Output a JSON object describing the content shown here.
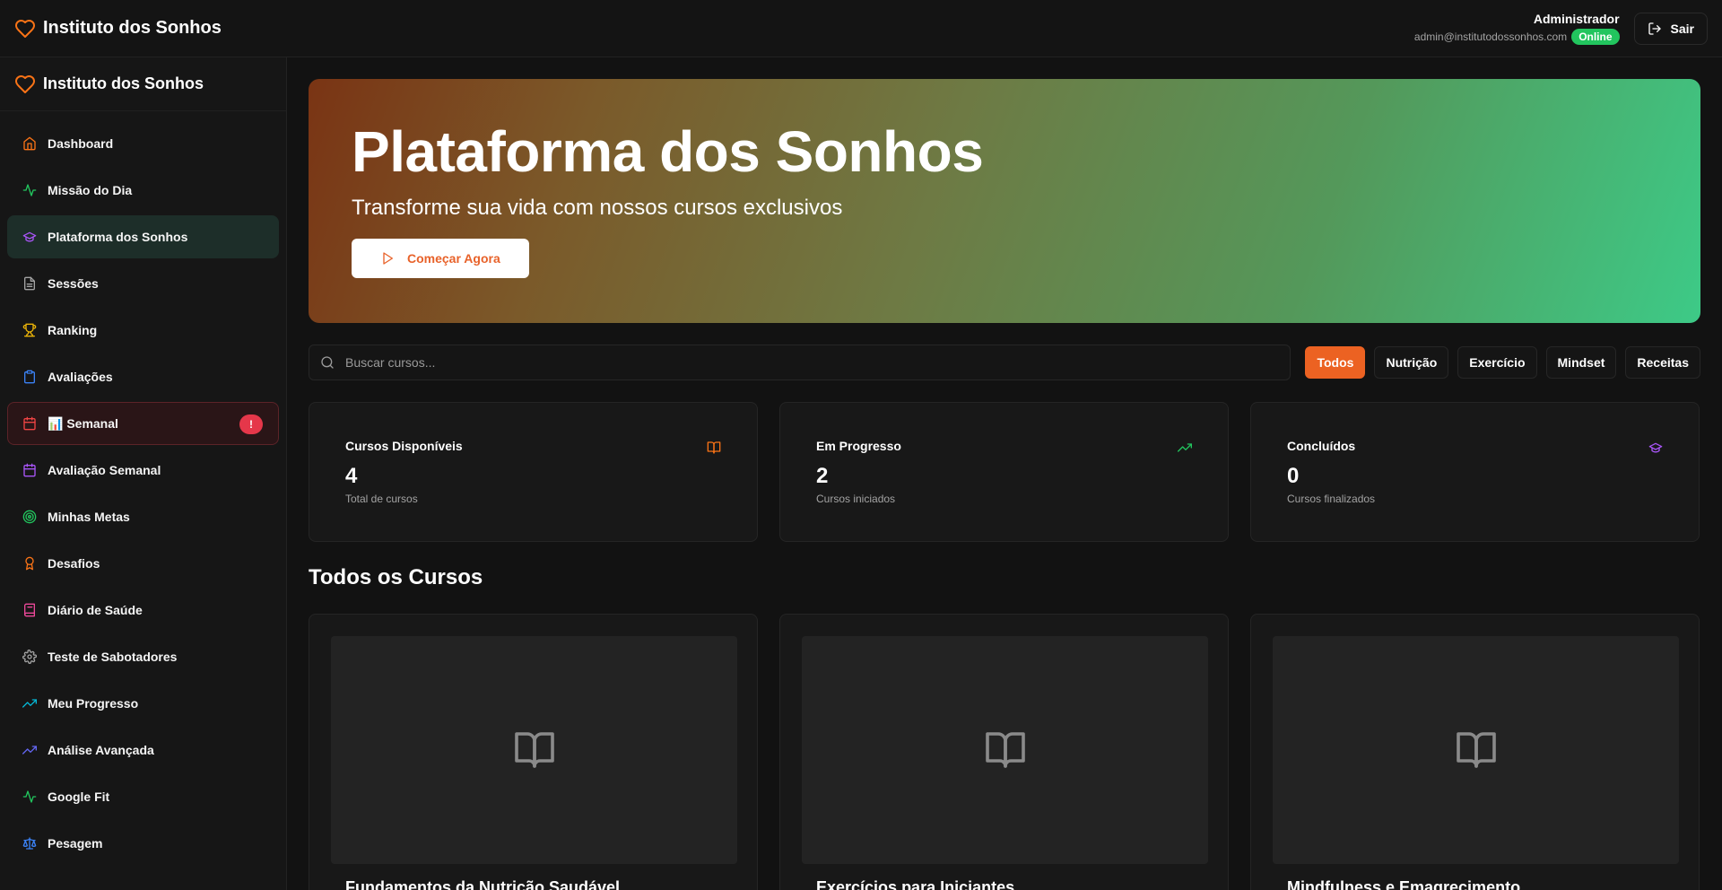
{
  "header": {
    "brand": "Instituto dos Sonhos",
    "user_name": "Administrador",
    "user_email": "admin@institutodossonhos.com",
    "status": "Online",
    "logout_label": "Sair"
  },
  "sidebar": {
    "brand": "Instituto dos Sonhos",
    "items": [
      {
        "label": "Dashboard",
        "icon": "home-icon",
        "color": "#f97316"
      },
      {
        "label": "Missão do Dia",
        "icon": "activity-icon",
        "color": "#22c55e"
      },
      {
        "label": "Plataforma dos Sonhos",
        "icon": "graduation-cap-icon",
        "color": "#a855f7",
        "active": true
      },
      {
        "label": "Sessões",
        "icon": "file-text-icon",
        "color": "#a3a3a3"
      },
      {
        "label": "Ranking",
        "icon": "trophy-icon",
        "color": "#eab308"
      },
      {
        "label": "Avaliações",
        "icon": "clipboard-icon",
        "color": "#3b82f6"
      },
      {
        "label": "📊 Semanal",
        "icon": "calendar-icon",
        "color": "#ef4444",
        "badge": "!"
      },
      {
        "label": "Avaliação Semanal",
        "icon": "calendar-icon",
        "color": "#a855f7"
      },
      {
        "label": "Minhas Metas",
        "icon": "target-icon",
        "color": "#22c55e"
      },
      {
        "label": "Desafios",
        "icon": "award-icon",
        "color": "#f97316"
      },
      {
        "label": "Diário de Saúde",
        "icon": "notebook-icon",
        "color": "#ec4899"
      },
      {
        "label": "Teste de Sabotadores",
        "icon": "settings-icon",
        "color": "#a3a3a3"
      },
      {
        "label": "Meu Progresso",
        "icon": "trending-up-icon",
        "color": "#06b6d4"
      },
      {
        "label": "Análise Avançada",
        "icon": "trending-up-icon",
        "color": "#6366f1"
      },
      {
        "label": "Google Fit",
        "icon": "activity-icon",
        "color": "#22c55e"
      },
      {
        "label": "Pesagem",
        "icon": "scale-icon",
        "color": "#3b82f6"
      }
    ]
  },
  "hero": {
    "title": "Plataforma dos Sonhos",
    "subtitle": "Transforme sua vida com nossos cursos exclusivos",
    "cta_label": "Começar Agora"
  },
  "search": {
    "placeholder": "Buscar cursos..."
  },
  "filters": [
    {
      "label": "Todos",
      "active": true
    },
    {
      "label": "Nutrição"
    },
    {
      "label": "Exercício"
    },
    {
      "label": "Mindset"
    },
    {
      "label": "Receitas"
    }
  ],
  "stats": [
    {
      "label": "Cursos Disponíveis",
      "value": "4",
      "sub": "Total de cursos",
      "icon": "book-open-icon",
      "color": "#f97316"
    },
    {
      "label": "Em Progresso",
      "value": "2",
      "sub": "Cursos iniciados",
      "icon": "trending-up-icon",
      "color": "#22c55e"
    },
    {
      "label": "Concluídos",
      "value": "0",
      "sub": "Cursos finalizados",
      "icon": "graduation-cap-icon",
      "color": "#a855f7"
    }
  ],
  "section_title": "Todos os Cursos",
  "courses": [
    {
      "title": "Fundamentos da Nutrição Saudável"
    },
    {
      "title": "Exercícios para Iniciantes"
    },
    {
      "title": "Mindfulness e Emagrecimento"
    }
  ]
}
